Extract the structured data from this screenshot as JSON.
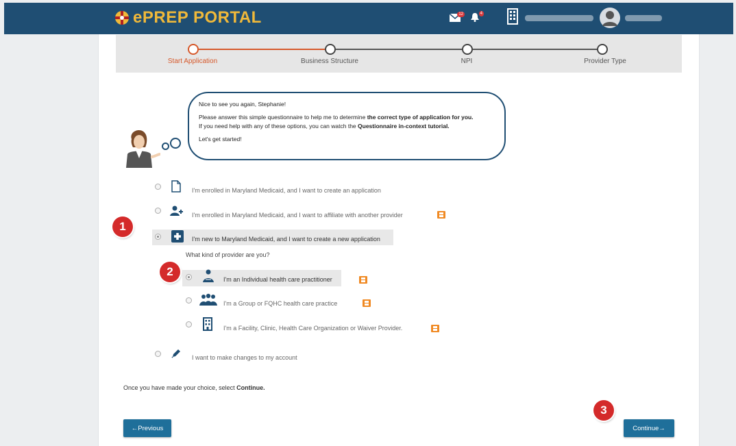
{
  "header": {
    "title": "ePREP PORTAL",
    "mail_badge": "12",
    "alert_badge": "4"
  },
  "stepper": {
    "steps": [
      {
        "label": "Start Application",
        "active": true
      },
      {
        "label": "Business Structure",
        "active": false
      },
      {
        "label": "NPI",
        "active": false
      },
      {
        "label": "Provider Type",
        "active": false
      }
    ]
  },
  "bubble": {
    "greeting": "Nice to see you again, Stephanie!",
    "line1_pre": "Please answer this simple questionnaire to help me to determine ",
    "line1_bold": "the correct type of application for you.",
    "line2_pre": "If you need help with any of these options, you can watch the ",
    "line2_bold": "Questionnaire in-context tutorial.",
    "start": "Let's get started!"
  },
  "options": {
    "enrolled_create": "I'm enrolled in Maryland Medicaid, and I want to create an application",
    "enrolled_affiliate": "I'm enrolled in Maryland Medicaid, and I want to affiliate with another provider",
    "new_create": "I'm new to Maryland Medicaid, and I want to create a new application",
    "provider_question": "What kind of provider are you?",
    "individual": "I'm an Individual health care practitioner",
    "group": "I'm a Group or FQHC health care practice",
    "facility": "I'm a Facility, Clinic, Health Care Organization or Waiver Provider.",
    "changes": "I want to make changes to my account"
  },
  "footnote": {
    "pre": "Once you have made your choice, select ",
    "bold": "Continue."
  },
  "buttons": {
    "previous": "←Previous",
    "continue": "Continue→"
  },
  "markers": [
    "1",
    "2",
    "3"
  ],
  "colors": {
    "header_bg": "#1f4e73",
    "brand_gold": "#f0b93a",
    "active_step": "#d6582a",
    "button": "#1f6f9a",
    "marker": "#d42a2a",
    "film_icon": "#f08a24"
  }
}
